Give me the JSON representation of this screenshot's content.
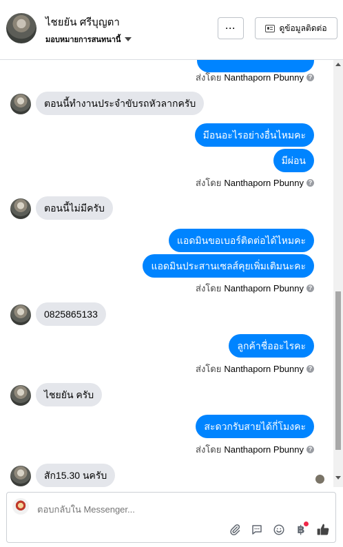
{
  "header": {
    "name": "ไชยยัน ศรีบุญตา",
    "subtitle": "มอบหมายการสนทนานี้",
    "more_label": "···",
    "contact_label": "ดูข้อมูลติดต่อ"
  },
  "sent_by_prefix": "ส่งโดย",
  "sender": "Nanthaporn Pbunny",
  "info_icon": "?",
  "messages": [
    {
      "dir": "in",
      "text": "ตอนนี้ทำงานประจำขับรถหัวลากครับ"
    },
    {
      "dir": "out",
      "text": "มีอนอะไรอย่างอื่นไหมคะ"
    },
    {
      "dir": "out",
      "text": "มีผ่อน"
    },
    {
      "dir": "in",
      "text": "ตอนนี้ไม่มีครับ"
    },
    {
      "dir": "out",
      "text": "แอดมินขอเบอร์ติดต่อได้ไหมคะ"
    },
    {
      "dir": "out",
      "text": "แอดมินประสานเซลส์คุยเพิ่มเติมนะคะ"
    },
    {
      "dir": "in",
      "text": "0825865133"
    },
    {
      "dir": "out",
      "text": "ลูกค้าชื่ออะไรคะ"
    },
    {
      "dir": "in",
      "text": "ไชยยัน ครับ"
    },
    {
      "dir": "out",
      "text": "สะดวกรับสายได้กี่โมงคะ"
    },
    {
      "dir": "in",
      "text": "สัก15.30 นครับ"
    }
  ],
  "composer": {
    "placeholder": "ตอบกลับใน Messenger..."
  },
  "icons": {
    "attach": "paperclip-icon",
    "saved_replies": "chat-bubble-icon",
    "emoji": "smiley-icon",
    "payment": "baht-icon",
    "like": "thumbs-up-icon"
  },
  "colors": {
    "outgoing_bubble": "#0084ff",
    "incoming_bubble": "#e4e6eb"
  }
}
